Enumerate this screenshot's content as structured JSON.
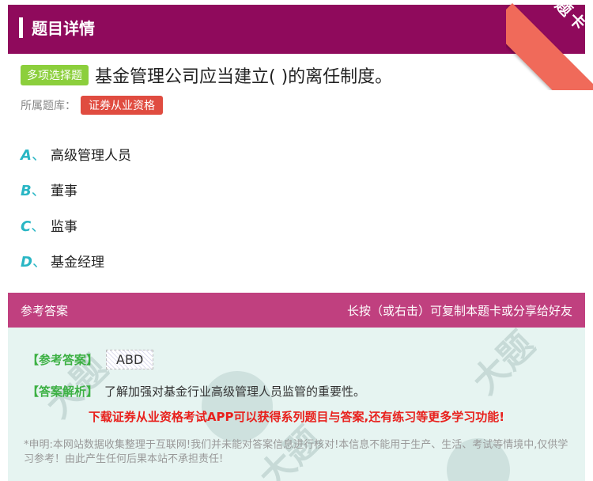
{
  "header": {
    "title": "题目详情",
    "ribbon_text": "题卡"
  },
  "question": {
    "type_badge": "多项选择题",
    "text": "基金管理公司应当建立( )的离任制度。",
    "library_label": "所属题库：",
    "library_tag": "证券从业资格"
  },
  "options": [
    {
      "letter": "A",
      "sep": "、",
      "text": "高级管理人员"
    },
    {
      "letter": "B",
      "sep": "、",
      "text": "董事"
    },
    {
      "letter": "C",
      "sep": "、",
      "text": "监事"
    },
    {
      "letter": "D",
      "sep": "、",
      "text": "基金经理"
    }
  ],
  "answer": {
    "head_left": "参考答案",
    "head_right": "长按（或右击）可复制本题卡或分享给好友",
    "ref_label": "【参考答案】",
    "ref_value": "ABD",
    "analysis_label": "【答案解析】",
    "analysis_text": "了解加强对基金行业高级管理人员监管的重要性。",
    "promo": "下载证券从业资格考试APP可以获得系列题目与答案,还有练习等更多学习功能!",
    "disclaimer": "*申明:本网站数据收集整理于互联网!我们并未能对答案信息进行核对!本信息不能用于生产、生活、考试等情境中,仅供学习参考！由此产生任何后果本站不承担责任!"
  },
  "colors": {
    "header_bg": "#8f0a5c",
    "ribbon": "#f06a5a",
    "type_badge": "#8ccf3c",
    "library_tag": "#e04c40",
    "option_letter": "#29b6c4",
    "answer_head": "#c0407f",
    "answer_body": "#e6f4f1",
    "label_green": "#3cb043",
    "promo_red": "#e8201c"
  }
}
